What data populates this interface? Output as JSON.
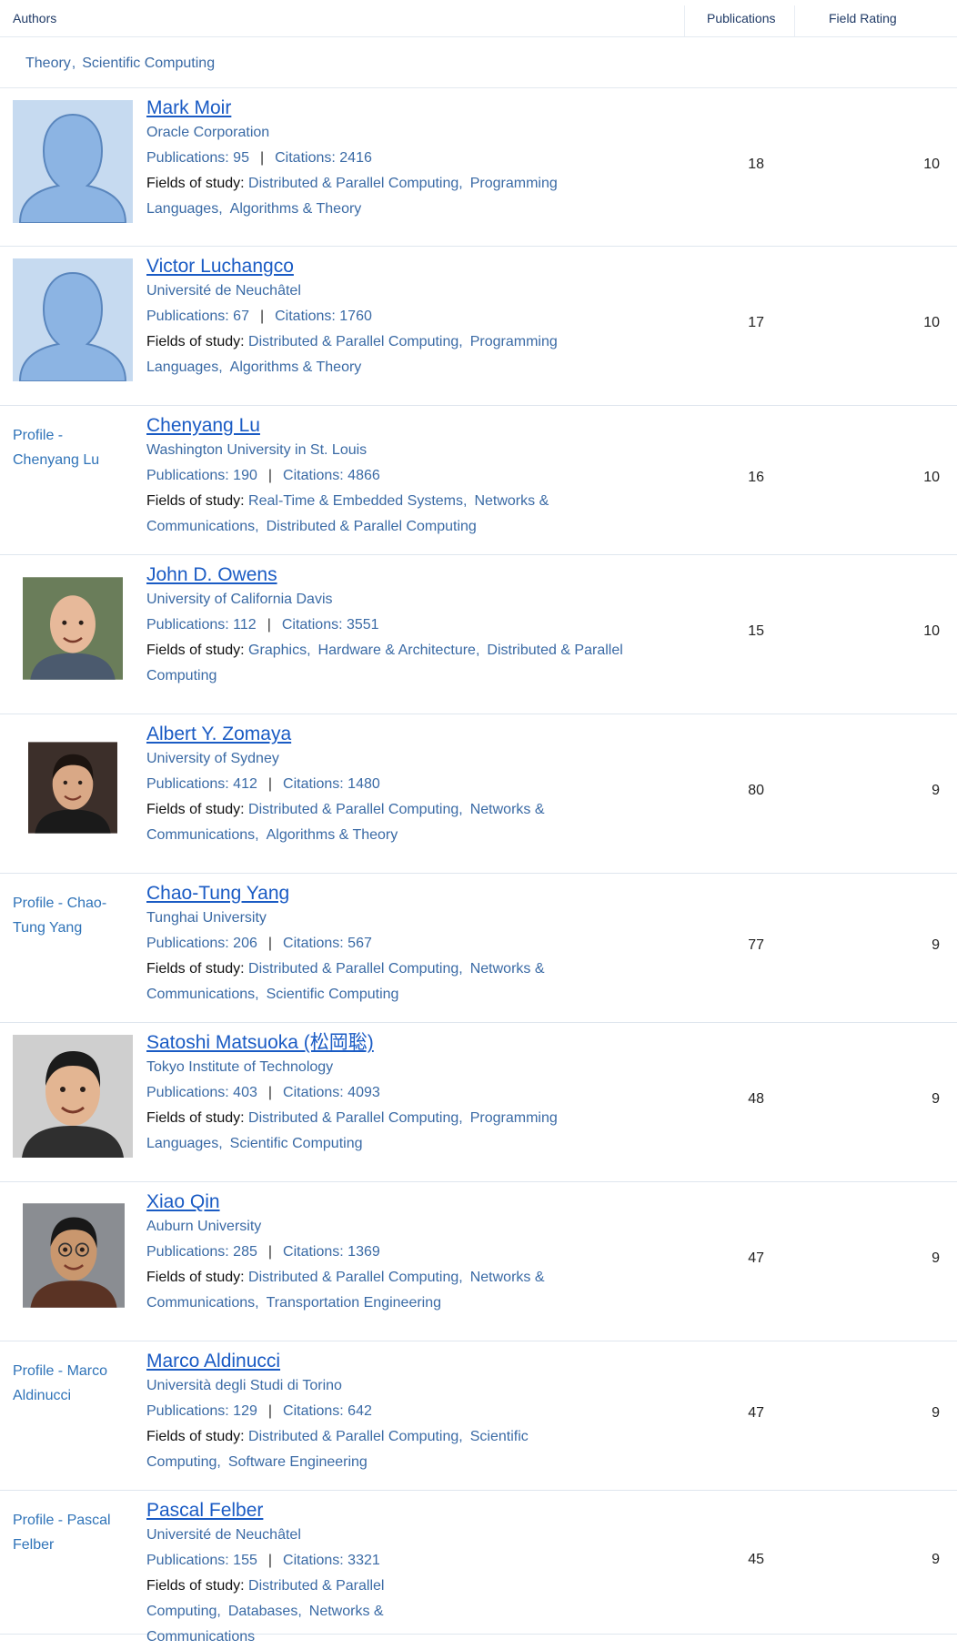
{
  "columns": {
    "authors": "Authors",
    "publications": "Publications",
    "field_rating": "Field Rating"
  },
  "filter": {
    "chips": [
      "Theory",
      "Scientific Computing"
    ]
  },
  "labels": {
    "publications": "Publications: ",
    "citations": "Citations: ",
    "fields": "Fields of study: ",
    "pipe": "|"
  },
  "rows": [
    {
      "name": "Mark Moir",
      "affiliation": "Oracle Corporation",
      "publications": "95",
      "citations": "2416",
      "fields": [
        "Distributed & Parallel Computing",
        "Programming Languages",
        "Algorithms & Theory"
      ],
      "pub_count": "18",
      "rating": "10",
      "photo": "silhouette-avatar",
      "profile": ""
    },
    {
      "name": "Victor Luchangco",
      "affiliation": "Université de Neuchâtel",
      "publications": "67",
      "citations": "1760",
      "fields": [
        "Distributed & Parallel Computing",
        "Programming Languages",
        "Algorithms & Theory"
      ],
      "pub_count": "17",
      "rating": "10",
      "photo": "silhouette-avatar",
      "profile": ""
    },
    {
      "name": "Chenyang Lu",
      "affiliation": "Washington University in St. Louis",
      "publications": "190",
      "citations": "4866",
      "fields": [
        "Real-Time & Embedded Systems",
        "Networks & Communications",
        "Distributed & Parallel Computing"
      ],
      "pub_count": "16",
      "rating": "10",
      "photo": "",
      "profile": "Profile - Chenyang Lu"
    },
    {
      "name": "John D. Owens",
      "affiliation": "University of California Davis",
      "publications": "112",
      "citations": "3551",
      "fields": [
        "Graphics",
        "Hardware & Architecture",
        "Distributed & Parallel Computing"
      ],
      "pub_count": "15",
      "rating": "10",
      "photo": "portrait-bald-smiling",
      "profile": ""
    },
    {
      "name": "Albert Y. Zomaya",
      "affiliation": "University of Sydney",
      "publications": "412",
      "citations": "1480",
      "fields": [
        "Distributed & Parallel Computing",
        "Networks & Communications",
        "Algorithms & Theory"
      ],
      "pub_count": "80",
      "rating": "9",
      "photo": "portrait-dark-hair",
      "profile": ""
    },
    {
      "name": "Chao-Tung Yang",
      "affiliation": "Tunghai University",
      "publications": "206",
      "citations": "567",
      "fields": [
        "Distributed & Parallel Computing",
        "Networks & Communications",
        "Scientific Computing"
      ],
      "pub_count": "77",
      "rating": "9",
      "photo": "",
      "profile": "Profile - Chao-Tung Yang"
    },
    {
      "name": "Satoshi Matsuoka (松岡聡)",
      "affiliation": "Tokyo Institute of Technology",
      "publications": "403",
      "citations": "4093",
      "fields": [
        "Distributed & Parallel Computing",
        "Programming Languages",
        "Scientific Computing"
      ],
      "pub_count": "48",
      "rating": "9",
      "photo": "portrait-black-hair",
      "profile": ""
    },
    {
      "name": "Xiao Qin",
      "affiliation": "Auburn University",
      "publications": "285",
      "citations": "1369",
      "fields": [
        "Distributed & Parallel Computing",
        "Networks & Communications",
        "Transportation Engineering"
      ],
      "pub_count": "47",
      "rating": "9",
      "photo": "portrait-glasses",
      "profile": ""
    },
    {
      "name": "Marco Aldinucci",
      "affiliation": "Università degli Studi di Torino",
      "publications": "129",
      "citations": "642",
      "fields": [
        "Distributed & Parallel Computing",
        "Scientific Computing",
        "Software Engineering"
      ],
      "pub_count": "47",
      "rating": "9",
      "photo": "",
      "profile": "Profile - Marco Aldinucci"
    },
    {
      "name": "Pascal Felber",
      "affiliation": "Université de Neuchâtel",
      "publications": "155",
      "citations": "3321",
      "fields": [
        "Distributed & Parallel Computing",
        "Databases",
        "Networks & Communications"
      ],
      "pub_count": "45",
      "rating": "9",
      "photo": "",
      "profile": "Profile - Pascal Felber"
    }
  ]
}
